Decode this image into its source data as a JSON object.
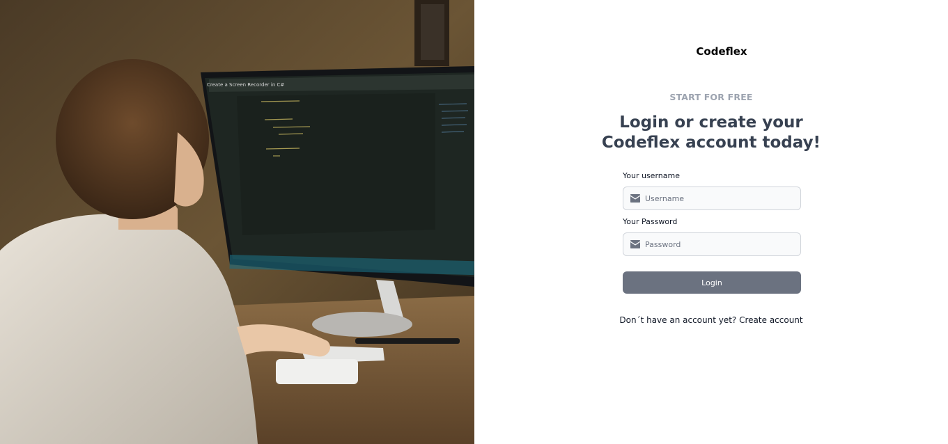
{
  "hero": {
    "image_alt": "Person coding at a desktop monitor",
    "monitor_title": "Create a Screen Recorder in C#"
  },
  "brand": {
    "name": "Codeflex"
  },
  "auth": {
    "eyebrow": "START FOR FREE",
    "headline_line1": "Login or create your",
    "headline_line2": "Codeflex account today!",
    "username": {
      "label": "Your username",
      "placeholder": "Username",
      "value": "",
      "icon": "envelope-icon"
    },
    "password": {
      "label": "Your Password",
      "placeholder": "Password",
      "value": "",
      "icon": "envelope-icon"
    },
    "login_label": "Login",
    "signup_prompt": "Don´t have an account yet?",
    "signup_link": "Create account"
  },
  "colors": {
    "button_bg": "#6b7280",
    "eyebrow": "#9ca3af",
    "headline": "#374151",
    "input_bg": "#f9fafb",
    "input_border": "#d1d5db"
  }
}
